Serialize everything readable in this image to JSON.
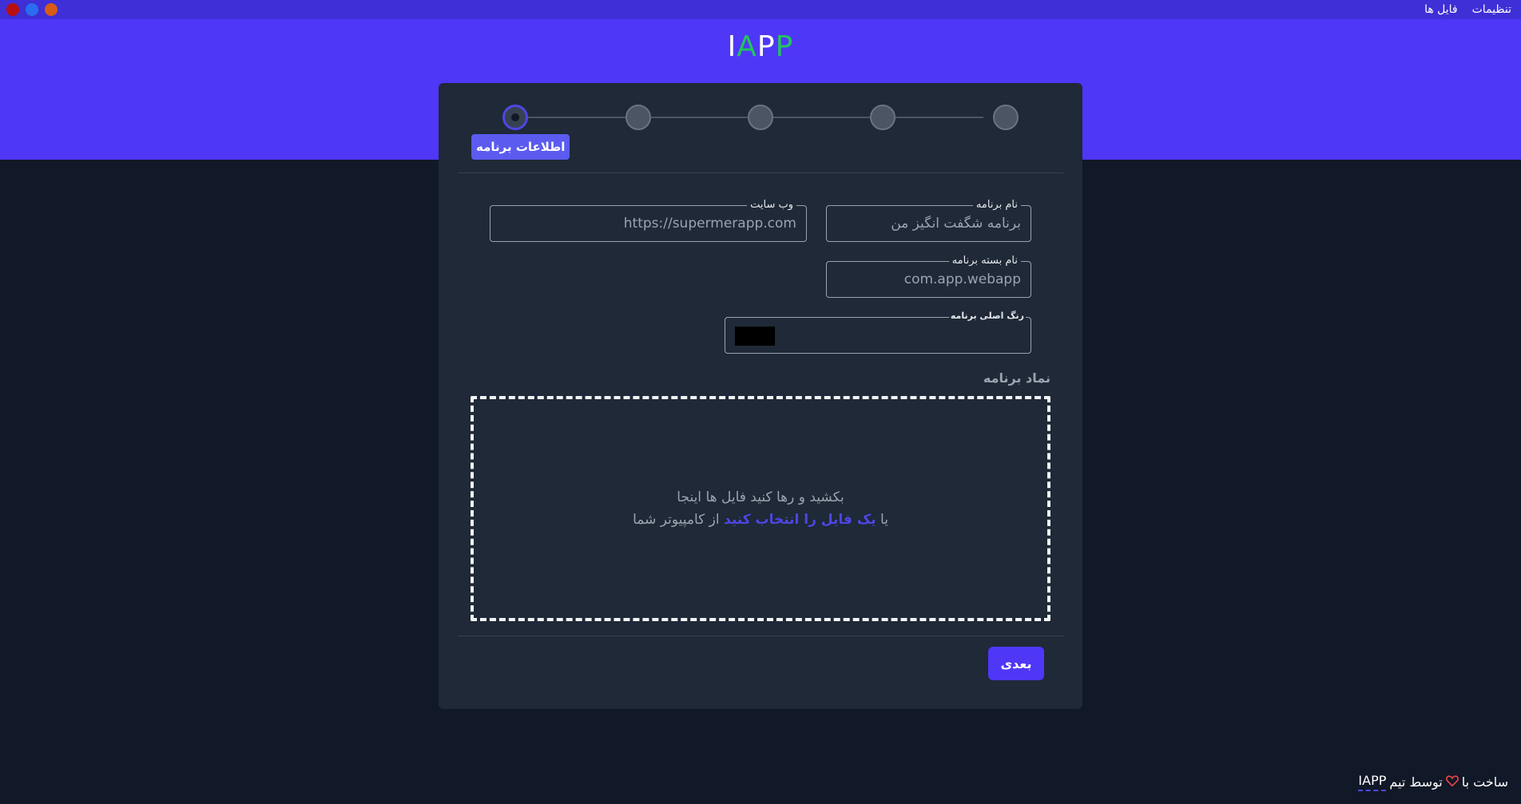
{
  "menu": {
    "items": [
      {
        "label": "فایل ها"
      },
      {
        "label": "تنظیمات"
      }
    ]
  },
  "logo": {
    "part1": "I",
    "part2": "A",
    "part3": "P",
    "part4": "P"
  },
  "stepper": {
    "active_step_label": "اطلاعات برنامه",
    "step_count": 5,
    "active_index": 0
  },
  "form": {
    "app_name": {
      "label": "نام برنامه",
      "placeholder": "برنامه شگفت انگیز من"
    },
    "website": {
      "label": "وب سایت",
      "placeholder": "https://supermerapp.com"
    },
    "package_name": {
      "label": "نام بسته برنامه",
      "placeholder": "com.app.webapp"
    },
    "primary_color": {
      "label": "رنگ اصلی برنامه",
      "value": "#000000"
    }
  },
  "icon_section": {
    "title": "نماد برنامه",
    "drop_line1": "بکشید و رها کنید فایل ها اینجا",
    "drop_line2_prefix": "یا",
    "drop_line2_link": "یک فایل را انتخاب کنید",
    "drop_line2_suffix": "از کامپیوتر شما"
  },
  "actions": {
    "next_label": "بعدی"
  },
  "footer": {
    "prefix": "ساخت با",
    "middle": "توسط تیم",
    "team": "IAPP"
  },
  "colors": {
    "accent": "#4f37f7",
    "logo_green": "#22c55e",
    "background": "#111827",
    "card": "#1f2937"
  }
}
